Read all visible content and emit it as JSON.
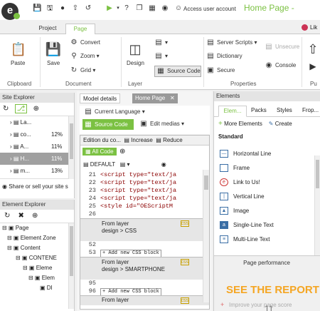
{
  "window": {
    "app_title": "Home Page - ",
    "account_label": "Access user account"
  },
  "tabs": [
    "Project",
    "Page"
  ],
  "like_label": "Lik",
  "ribbon": {
    "clipboard": {
      "paste": "Paste",
      "label": "Clipboard"
    },
    "document": {
      "save": "Save",
      "convert": "Convert",
      "zoom": "Zoom",
      "grid": "Grid",
      "label": "Document"
    },
    "layer": {
      "design": "Design",
      "source_code": "Source Code",
      "label": "Layer"
    },
    "properties": {
      "server_scripts": "Server Scripts",
      "dictionary": "Dictionary",
      "secure": "Secure",
      "unsecure": "Unsecure",
      "console": "Console",
      "label": "Properties"
    },
    "publish_label": "Pu"
  },
  "site_explorer": {
    "title": "Site Explorer",
    "rows": [
      {
        "name": "La...",
        "pct": ""
      },
      {
        "name": "co...",
        "pct": "12%"
      },
      {
        "name": "A...",
        "pct": "11%"
      },
      {
        "name": "H...",
        "pct": "11%"
      },
      {
        "name": "m...",
        "pct": "13%"
      }
    ],
    "share": "Share or sell your site s"
  },
  "element_explorer": {
    "title": "Element Explorer",
    "nodes": [
      "Page",
      "Element Zone",
      "Content",
      "CONTENE",
      "Eleme",
      "Elem",
      "DI"
    ]
  },
  "middle": {
    "tab_model": "Model details",
    "tab_home": "Home Page",
    "current_language": "Current Language",
    "source_code": "Source Code",
    "edit_medias": "Edit medias",
    "edition_title": "Edition du co...",
    "increase": "Increase",
    "reduce": "Reduce",
    "all_code": "All Code",
    "default": "DEFAULT",
    "code_lines": [
      {
        "n": "21",
        "t": "<script type=\"text/ja"
      },
      {
        "n": "22",
        "t": "<script type=\"text/ja"
      },
      {
        "n": "23",
        "t": "<script type=\"text/ja"
      },
      {
        "n": "24",
        "t": "<script type=\"text/ja"
      },
      {
        "n": "25",
        "t": "<style id=\"OEScriptM"
      },
      {
        "n": "26",
        "t": ""
      }
    ],
    "blocks": [
      {
        "title": "From layer\ndesign > CSS",
        "ln1": "52",
        "ln2": "53",
        "add": "+ Add new CSS block"
      },
      {
        "title": "From layer\ndesign > SMARTPHONE",
        "ln1": "95",
        "ln2": "96",
        "add": "+ Add new CSS block"
      },
      {
        "title": "From layer",
        "ln1": "99",
        "ln2": "100",
        "add": ""
      }
    ]
  },
  "elements_panel": {
    "title": "Elements",
    "tabs": [
      "Elem...",
      "Packs",
      "Styles",
      "Frop..."
    ],
    "more": "More Elements",
    "create": "Create",
    "section": "Standard",
    "items": [
      {
        "label": "Horizontal Line",
        "icon": "hr-icon"
      },
      {
        "label": "Frame",
        "icon": "frame-icon"
      },
      {
        "label": "Link to Us!",
        "icon": "link-icon"
      },
      {
        "label": "Vertical Line",
        "icon": "vr-icon"
      },
      {
        "label": "Image",
        "icon": "image-icon"
      },
      {
        "label": "Single-Line Text",
        "icon": "text-icon"
      },
      {
        "label": "Multi-Line Text",
        "icon": "multitext-icon"
      }
    ],
    "perf": "Page performance",
    "see_report": "SEE THE REPORT",
    "perf_faint": "Improve your page score",
    "score": "11"
  },
  "colors": {
    "accent": "#7bc142",
    "orange": "#f5a623",
    "selected_row": "#a0a0a0"
  }
}
